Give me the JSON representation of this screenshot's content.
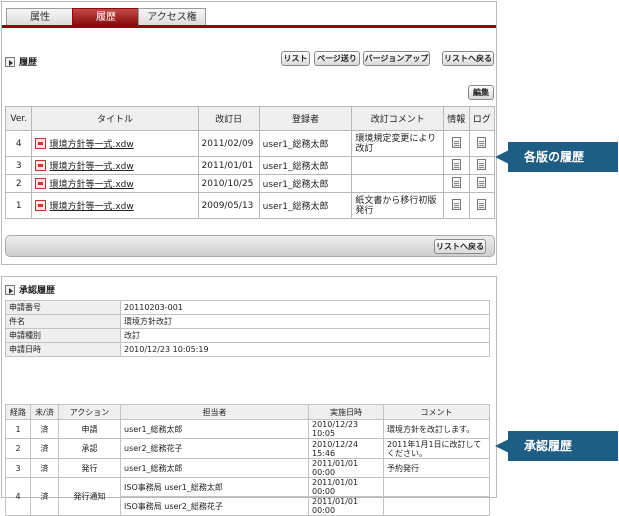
{
  "tabs": [
    "属性",
    "履歴",
    "アクセス権"
  ],
  "history": {
    "title": "履歴",
    "buttons": {
      "list": "リスト",
      "page_send": "ページ送り",
      "version_up": "バージョンアップ",
      "back_to_list": "リストへ戻る",
      "edit": "編集"
    },
    "columns": [
      "Ver.",
      "タイトル",
      "改訂日",
      "登録者",
      "改訂コメント",
      "情報",
      "ログ"
    ],
    "rows": [
      {
        "ver": "4",
        "title": "環境方針等一式.xdw",
        "date": "2011/02/09",
        "user": "user1_総務太郎",
        "comment": "環境規定変更により改訂"
      },
      {
        "ver": "3",
        "title": "環境方針等一式.xdw",
        "date": "2011/01/01",
        "user": "user1_総務太郎",
        "comment": ""
      },
      {
        "ver": "2",
        "title": "環境方針等一式.xdw",
        "date": "2010/10/25",
        "user": "user1_総務太郎",
        "comment": ""
      },
      {
        "ver": "1",
        "title": "環境方針等一式.xdw",
        "date": "2009/05/13",
        "user": "user1_総務太郎",
        "comment": "紙文書から移行初版発行"
      }
    ],
    "footer_button": "リストへ戻る"
  },
  "approval": {
    "title": "承認履歴",
    "info": [
      {
        "label": "申請番号",
        "value": "20110203-001"
      },
      {
        "label": "件名",
        "value": "環境方針改訂"
      },
      {
        "label": "申請種別",
        "value": "改訂"
      },
      {
        "label": "申請日時",
        "value": "2010/12/23 10:05:19"
      }
    ],
    "columns": [
      "経路",
      "未/済",
      "アクション",
      "担当者",
      "実施日時",
      "コメント"
    ],
    "rows": [
      {
        "route": "1",
        "status": "済",
        "action": "申請",
        "assignee": "user1_総務太郎",
        "datetime": "2010/12/23 10:05",
        "comment": "環境方針を改訂します。"
      },
      {
        "route": "2",
        "status": "済",
        "action": "承認",
        "assignee": "user2_総務花子",
        "datetime": "2010/12/24 15:46",
        "comment": "2011年1月1日に改訂してください。"
      },
      {
        "route": "3",
        "status": "済",
        "action": "発行",
        "assignee": "user1_総務太郎",
        "datetime": "2011/01/01 00:00",
        "comment": "予約発行"
      },
      {
        "route": "4",
        "status": "済",
        "action": "発行通知",
        "assignees": [
          "ISO事務局 user1_総務太郎",
          "ISO事務局 user2_総務花子"
        ],
        "datetimes": [
          "2011/01/01 00:00",
          "2011/01/01 00:00"
        ]
      }
    ]
  },
  "callouts": {
    "versions": "各版の履歴",
    "approval": "承認履歴"
  }
}
